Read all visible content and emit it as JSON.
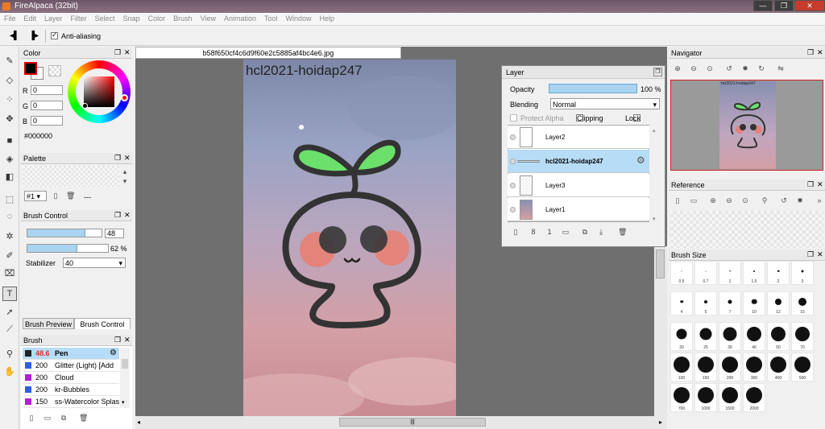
{
  "window": {
    "title": "FireAlpaca (32bit)",
    "min": "—",
    "max": "❐",
    "close": "✕"
  },
  "menu": [
    "File",
    "Edit",
    "Layer",
    "Filter",
    "Select",
    "Snap",
    "Color",
    "Brush",
    "View",
    "Animation",
    "Tool",
    "Window",
    "Help"
  ],
  "toolbar": {
    "anti_aliasing": "Anti-aliasing"
  },
  "color_panel": {
    "title": "Color",
    "r_label": "R",
    "r_value": "0",
    "g_label": "G",
    "g_value": "0",
    "b_label": "B",
    "b_value": "0",
    "hex": "#000000"
  },
  "palette_panel": {
    "title": "Palette",
    "selector": "#1",
    "dash": "---"
  },
  "brush_control": {
    "title": "Brush Control",
    "size": "48",
    "size_fill": 0.78,
    "opacity": "62 %",
    "opacity_fill": 0.62,
    "stabilizer_label": "Stabilizer",
    "stabilizer_value": "40"
  },
  "tabs": {
    "preview": "Brush Preview",
    "control": "Brush Control"
  },
  "brush_panel": {
    "title": "Brush",
    "items": [
      {
        "size": "48.6",
        "name": "Pen",
        "color": "#222222"
      },
      {
        "size": "200",
        "name": "Glitter (Light) [Add",
        "color": "#3060e0"
      },
      {
        "size": "200",
        "name": "Cloud",
        "color": "#b020d0"
      },
      {
        "size": "200",
        "name": "kr-Bubbles",
        "color": "#3060e0"
      },
      {
        "size": "150",
        "name": "ss-Watercolor Splas",
        "color": "#b020d0"
      }
    ]
  },
  "document": {
    "tab": "b58f650cf4c6d9f60e2c5885af4bc4e6.jpg",
    "watermark": "hcl2021-hoidap247"
  },
  "layer_window": {
    "title": "Layer",
    "opacity_label": "Opacity",
    "opacity_value": "100 %",
    "blending_label": "Blending",
    "blending_value": "Normal",
    "protect_alpha": "Protect Alpha",
    "clipping": "Clipping",
    "lock": "Lock",
    "layers": [
      "Layer2",
      "hcl2021-hoidap247",
      "Layer3",
      "Layer1"
    ]
  },
  "navigator": {
    "title": "Navigator"
  },
  "reference": {
    "title": "Reference"
  },
  "brush_size": {
    "title": "Brush Size",
    "sizes": [
      "0.5",
      "0.7",
      "1",
      "1.5",
      "2",
      "3",
      "4",
      "5",
      "7",
      "10",
      "12",
      "15",
      "20",
      "25",
      "30",
      "40",
      "50",
      "70",
      "100",
      "150",
      "200",
      "300",
      "400",
      "500",
      "700",
      "1000",
      "1500",
      "2000"
    ]
  },
  "colors": {
    "accent": "#b7dcf5",
    "nav_border": "#d21f1f",
    "sprout_green": "#6be06b"
  }
}
